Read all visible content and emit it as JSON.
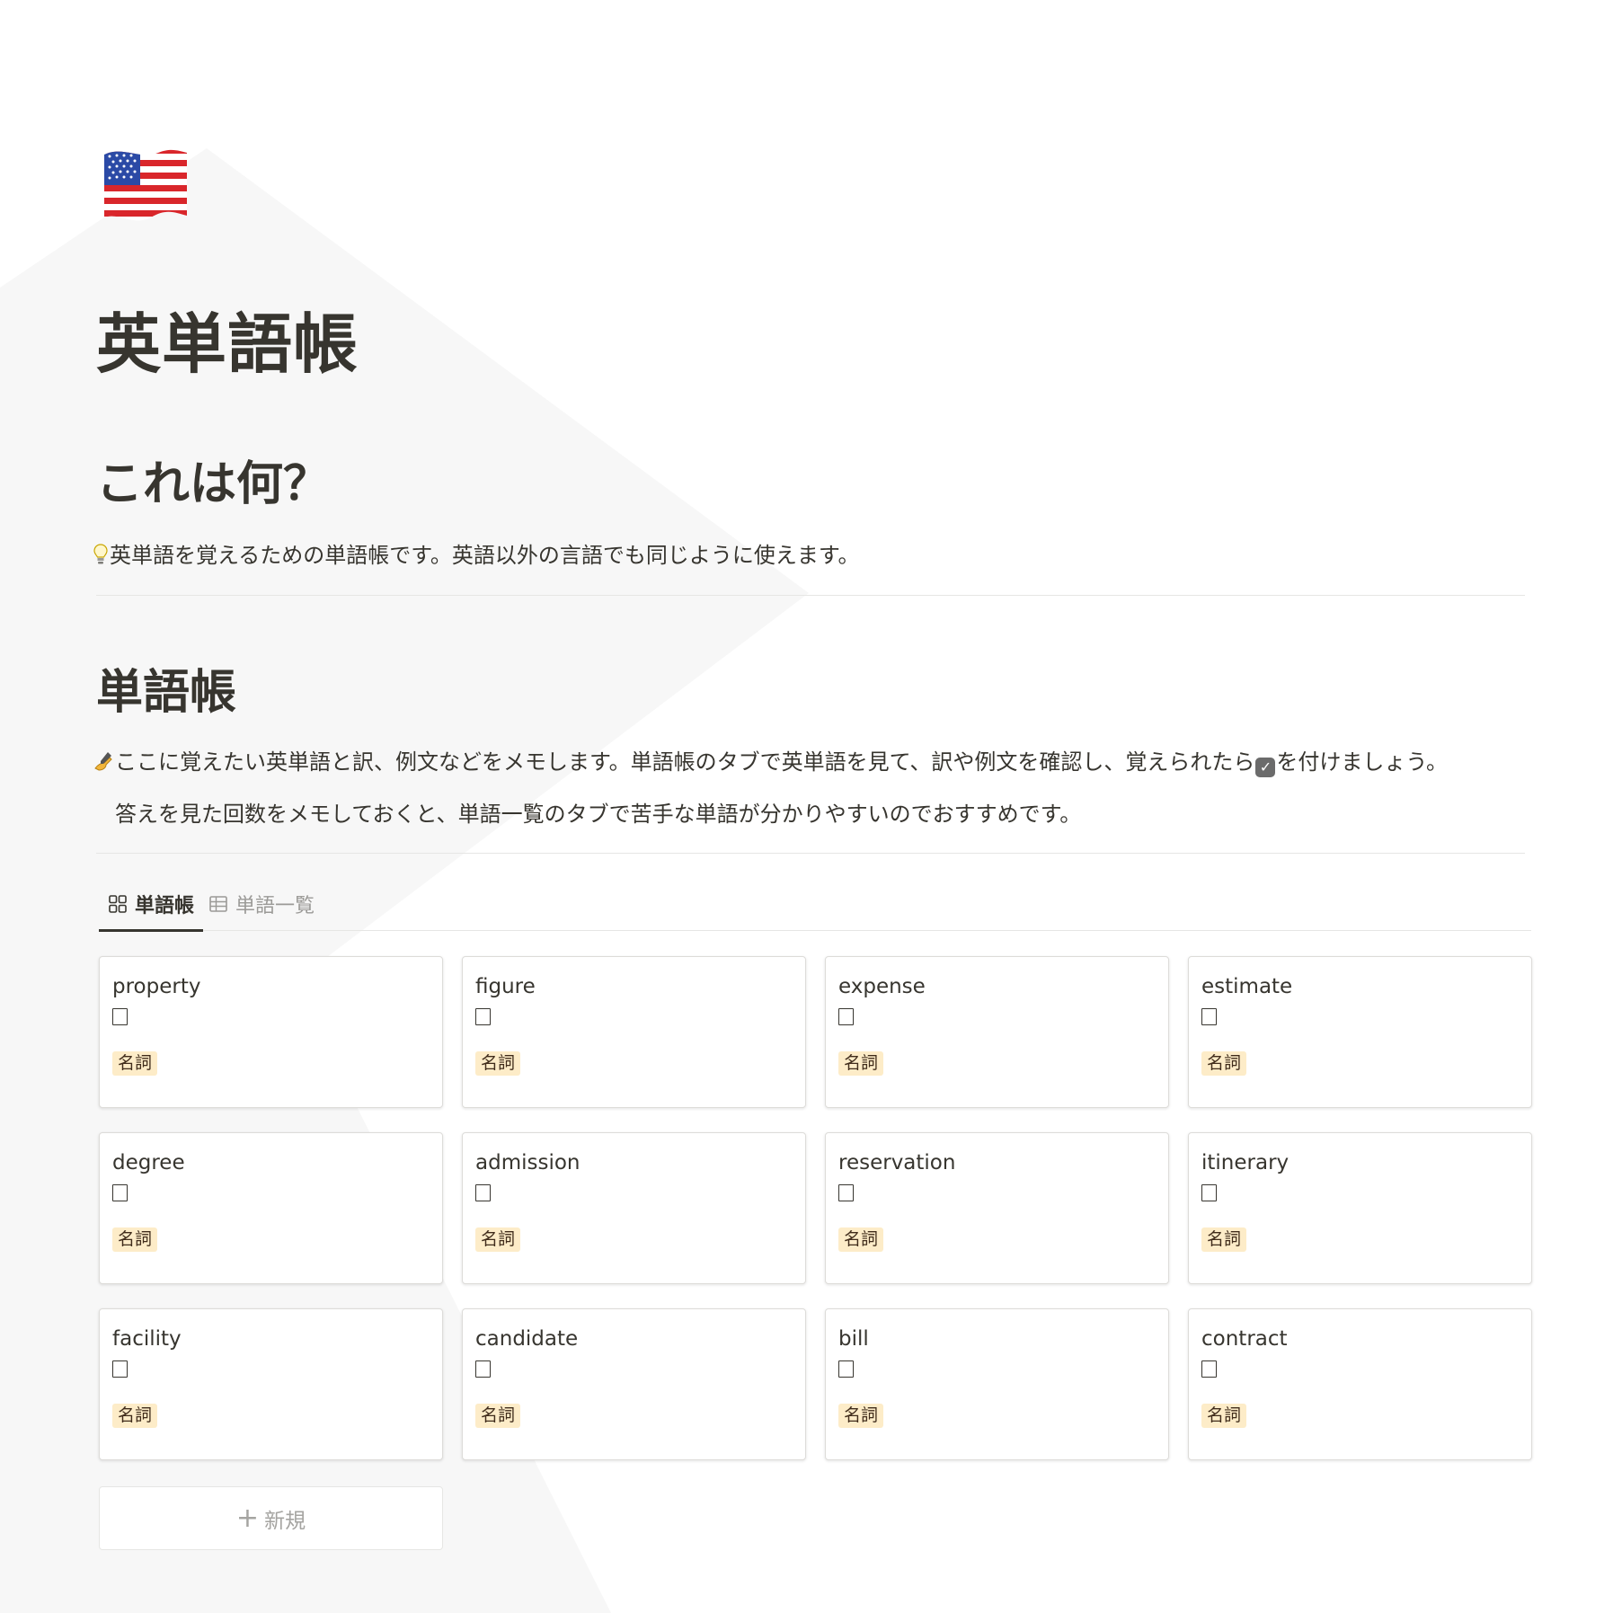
{
  "page": {
    "icon": "us-flag-icon",
    "title": "英単語帳"
  },
  "section_what": {
    "heading": "これは何？",
    "bullet_icon": "lightbulb-icon",
    "text": "英単語を覚えるための単語帳です。英語以外の言語でも同じように使えます。"
  },
  "section_vocab": {
    "heading": "単語帳",
    "writing_icon": "writing-hand-icon",
    "text1_before": "ここに覚えたい英単語と訳、例文などをメモします。単語帳のタブで英単語を見て、訳や例文を確認し、覚えられたら",
    "check_icon": "check-box-icon",
    "check_glyph": "✓",
    "text1_after": "を付けましょう。",
    "text2": "答えを見た回数をメモしておくと、単語一覧のタブで苦手な単語が分かりやすいのでおすすめです。"
  },
  "tabs": [
    {
      "label": "単語帳",
      "icon": "gallery-icon",
      "active": true
    },
    {
      "label": "単語一覧",
      "icon": "table-icon",
      "active": false
    }
  ],
  "cards": [
    {
      "word": "property",
      "checked": false,
      "tag": "名詞"
    },
    {
      "word": "figure",
      "checked": false,
      "tag": "名詞"
    },
    {
      "word": "expense",
      "checked": false,
      "tag": "名詞"
    },
    {
      "word": "estimate",
      "checked": false,
      "tag": "名詞"
    },
    {
      "word": "degree",
      "checked": false,
      "tag": "名詞"
    },
    {
      "word": "admission",
      "checked": false,
      "tag": "名詞"
    },
    {
      "word": "reservation",
      "checked": false,
      "tag": "名詞"
    },
    {
      "word": "itinerary",
      "checked": false,
      "tag": "名詞"
    },
    {
      "word": "facility",
      "checked": false,
      "tag": "名詞"
    },
    {
      "word": "candidate",
      "checked": false,
      "tag": "名詞"
    },
    {
      "word": "bill",
      "checked": false,
      "tag": "名詞"
    },
    {
      "word": "contract",
      "checked": false,
      "tag": "名詞"
    }
  ],
  "new_button": {
    "icon": "plus-icon",
    "label": "新規"
  },
  "colors": {
    "text": "#37352f",
    "tag_bg": "#fdecc8",
    "muted": "#9b9a97",
    "divider": "#e6e6e4"
  }
}
